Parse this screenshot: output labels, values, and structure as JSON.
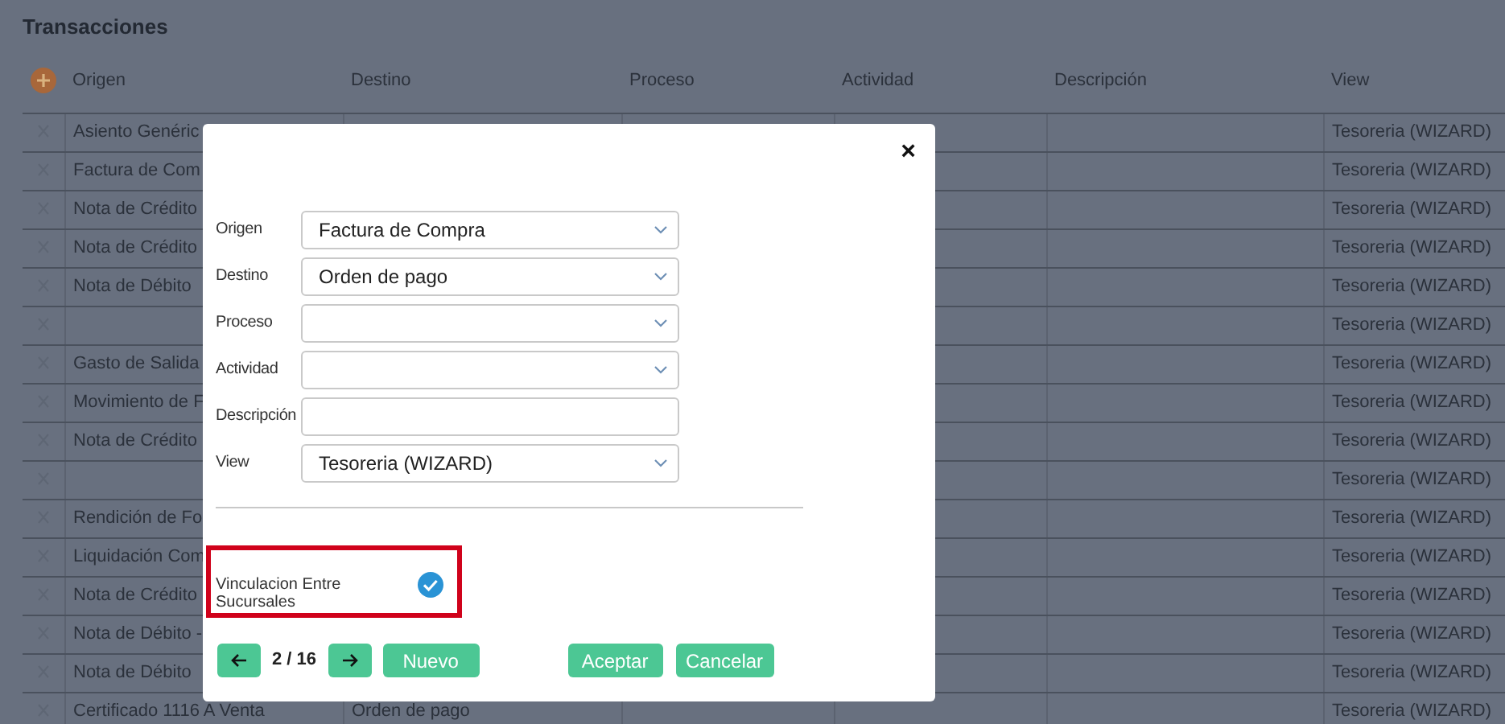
{
  "page": {
    "title": "Transacciones"
  },
  "table": {
    "columns": [
      "Origen",
      "Destino",
      "Proceso",
      "Actividad",
      "Descripción",
      "View"
    ],
    "rows": [
      {
        "origen": "Asiento Genéric",
        "view": "Tesoreria (WIZARD)"
      },
      {
        "origen": "Factura de Com",
        "view": "Tesoreria (WIZARD)"
      },
      {
        "origen": "Nota de Crédito",
        "view": "Tesoreria (WIZARD)"
      },
      {
        "origen": "Nota de Crédito",
        "view": "Tesoreria (WIZARD)"
      },
      {
        "origen": "Nota de Débito",
        "view": "Tesoreria (WIZARD)"
      },
      {
        "view": "Tesoreria (WIZARD)"
      },
      {
        "origen": "Gasto de Salida",
        "view": "Tesoreria (WIZARD)"
      },
      {
        "origen": "Movimiento de F",
        "view": "Tesoreria (WIZARD)"
      },
      {
        "origen": "Nota de Crédito",
        "view": "Tesoreria (WIZARD)"
      },
      {
        "view": "Tesoreria (WIZARD)"
      },
      {
        "origen": "Rendición de Fo",
        "view": "Tesoreria (WIZARD)"
      },
      {
        "origen": "Liquidación Com",
        "view": "Tesoreria (WIZARD)"
      },
      {
        "origen": "Nota de Crédito",
        "view": "Tesoreria (WIZARD)"
      },
      {
        "origen": "Nota de Débito -",
        "view": "Tesoreria (WIZARD)"
      },
      {
        "origen": "Nota de Débito",
        "view": "Tesoreria (WIZARD)"
      },
      {
        "origen": "Certificado 1116 A Venta",
        "destino": "Orden de pago",
        "view": "Tesoreria (WIZARD)"
      }
    ]
  },
  "dialog": {
    "close": "×",
    "fields": [
      {
        "label": "Origen",
        "kind": "select",
        "value": "Factura de Compra"
      },
      {
        "label": "Destino",
        "kind": "select",
        "value": "Orden de pago"
      },
      {
        "label": "Proceso",
        "kind": "select"
      },
      {
        "label": "Actividad",
        "kind": "select"
      },
      {
        "label": "Descripción",
        "kind": "text"
      },
      {
        "label": "View",
        "kind": "select",
        "value": "Tesoreria (WIZARD)"
      }
    ],
    "checkbox": {
      "label": "Vinculacion Entre Sucursales",
      "checked": true
    },
    "pager": "2 / 16",
    "buttons": {
      "new": "Nuevo",
      "accept": "Aceptar",
      "cancel": "Cancelar"
    }
  }
}
